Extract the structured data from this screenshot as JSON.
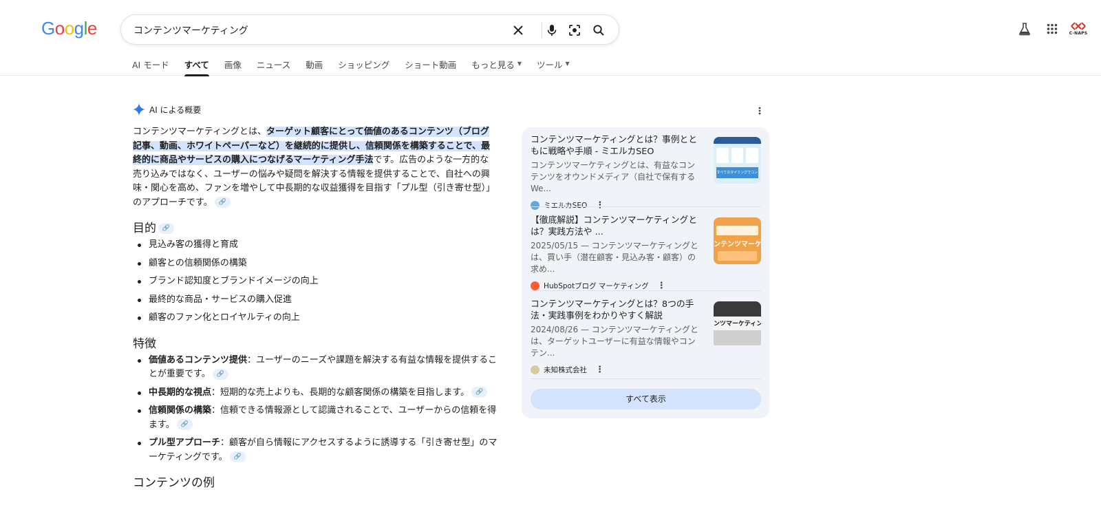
{
  "search": {
    "query": "コンテンツマーケティング"
  },
  "tabs": [
    {
      "label": "AI モード"
    },
    {
      "label": "すべて"
    },
    {
      "label": "画像"
    },
    {
      "label": "ニュース"
    },
    {
      "label": "動画"
    },
    {
      "label": "ショッピング"
    },
    {
      "label": "ショート動画"
    },
    {
      "label": "もっと見る"
    },
    {
      "label": "ツール"
    }
  ],
  "account": {
    "logo_text": "C-NAPS"
  },
  "ai_overview": {
    "heading": "AI による概要",
    "intro_lead": "コンテンツマーケティングとは、",
    "intro_highlight": "ターゲット顧客にとって価値のあるコンテンツ（ブログ記事、動画、ホワイトペーパーなど）を継続的に提供し、信頼関係を構築することで、最終的に商品やサービスの購入につなげるマーケティング手法",
    "intro_rest": "です。広告のような一方的な売り込みではなく、ユーザーの悩みや疑問を解決する情報を提供することで、自社への興味・関心を高め、ファンを増やして中長期的な収益獲得を目指す「プル型（引き寄せ型）」のアプローチです。",
    "purpose_heading": "目的",
    "purpose_items": [
      "見込み客の獲得と育成",
      "顧客との信頼関係の構築",
      "ブランド認知度とブランドイメージの向上",
      "最終的な商品・サービスの購入促進",
      "顧客のファン化とロイヤルティの向上"
    ],
    "features_heading": "特徴",
    "features": [
      {
        "term": "価値あるコンテンツ提供",
        "sep": "：",
        "text": "ユーザーのニーズや課題を解決する有益な情報を提供することが重要です。"
      },
      {
        "term": "中長期的な視点",
        "sep": "：",
        "text": "短期的な売上よりも、長期的な顧客関係の構築を目指します。"
      },
      {
        "term": "信頼関係の構築",
        "sep": "：",
        "text": "信頼できる情報源として認識されることで、ユーザーからの信頼を得ます。"
      },
      {
        "term": "プル型アプローチ",
        "sep": "：",
        "text": "顧客が自ら情報にアクセスするように誘導する「引き寄せ型」のマーケティングです。"
      }
    ],
    "examples_heading": "コンテンツの例"
  },
  "sources": [
    {
      "title": "コンテンツマーケティングとは？事例とともに戦略や手順 - ミエルカSEO",
      "snippet": "コンテンツマーケティングとは、有益なコンテンツをオウンドメディア（自社で保有するWe...",
      "site": "ミエルカSEO",
      "favicon_color": "#5aa9e6"
    },
    {
      "title": "【徹底解説】コンテンツマーケティングとは？実践方法や ...",
      "snippet": "2025/05/15 — コンテンツマーケティングとは、買い手（潜在顧客・見込み客・顧客）の求め...",
      "site": "HubSpotブログ マーケティング",
      "favicon_color": "#ff5c35"
    },
    {
      "title": "コンテンツマーケティングとは？8つの手法・実践事例をわかりやすく解説",
      "snippet": "2024/08/26 — コンテンツマーケティングとは、ターゲットユーザーに有益な情報やコンテン...",
      "site": "未知株式会社",
      "favicon_color": "#d8c9a3"
    }
  ],
  "show_all_label": "すべて表示",
  "thumbs": {
    "t1_text": "すべてのタイミングでコンテンツ",
    "t2_text": "ンテンツマーケティ",
    "t3_text": "ンツマーケティング"
  }
}
